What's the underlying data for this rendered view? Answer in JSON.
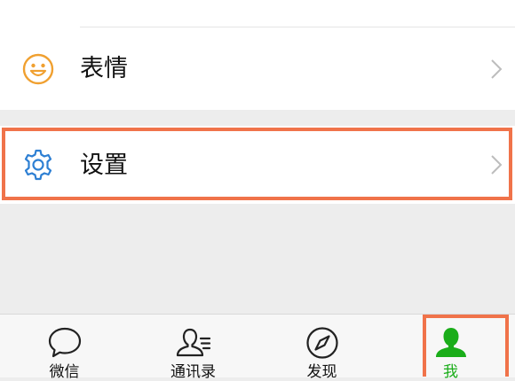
{
  "menu": {
    "items": [
      {
        "label": "表情",
        "icon": "smiley-icon"
      },
      {
        "label": "设置",
        "icon": "gear-icon"
      }
    ]
  },
  "tabbar": {
    "tabs": [
      {
        "label": "微信",
        "icon": "chat-bubble-icon"
      },
      {
        "label": "通讯录",
        "icon": "contacts-icon"
      },
      {
        "label": "发现",
        "icon": "compass-icon"
      },
      {
        "label": "我",
        "icon": "person-icon",
        "active": true
      }
    ]
  },
  "colors": {
    "accent": "#1aad19",
    "highlight": "#f0734a",
    "emoji_icon": "#f0a030",
    "settings_icon": "#2d7fd3"
  }
}
